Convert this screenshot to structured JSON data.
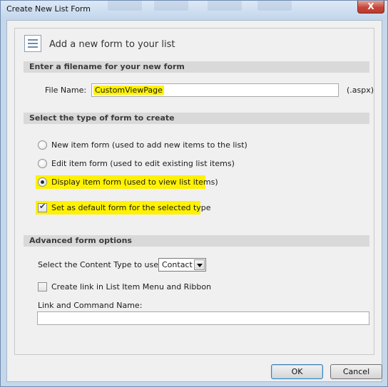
{
  "window": {
    "title": "Create New List Form",
    "close_label": "X"
  },
  "header": {
    "title": "Add a new form to your list"
  },
  "filename_section": {
    "heading": "Enter a filename for your new form",
    "label": "File Name:",
    "value": "CustomViewPage",
    "extension": "(.aspx)"
  },
  "type_section": {
    "heading": "Select the type of form to create",
    "options": [
      {
        "label": "New item form (used to add new items to the list)",
        "checked": false
      },
      {
        "label": "Edit item form (used to edit existing list items)",
        "checked": false
      },
      {
        "label": "Display item form (used to view list items)",
        "checked": true
      }
    ],
    "default_checkbox": {
      "label": "Set as default form for the selected type",
      "checked": true
    }
  },
  "advanced_section": {
    "heading": "Advanced form options",
    "content_type_label": "Select the Content Type to use:",
    "content_type_value": "Contact",
    "create_link_label": "Create link in List Item Menu and Ribbon",
    "create_link_checked": false,
    "link_name_label": "Link and Command Name:",
    "link_name_value": ""
  },
  "buttons": {
    "ok": "OK",
    "cancel": "Cancel"
  },
  "colors": {
    "highlight": "#fff200",
    "section_bar": "#d9d9d9",
    "titlebar": "#c6d9ee"
  }
}
